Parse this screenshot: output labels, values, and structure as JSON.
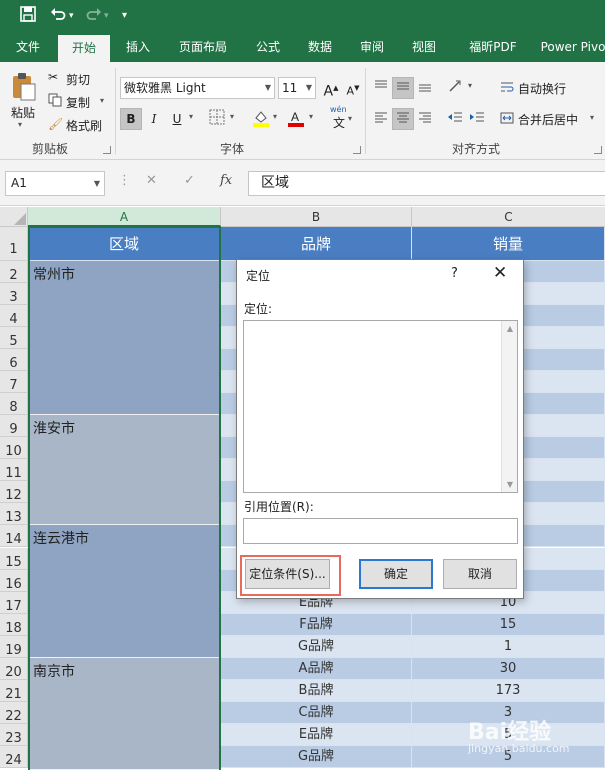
{
  "title_bar": {
    "save_icon": "save-icon",
    "undo_icon": "undo-icon",
    "redo_icon": "redo-icon",
    "customize_icon": "chevron-down-icon"
  },
  "ribbon_tabs": [
    "文件",
    "开始",
    "插入",
    "页面布局",
    "公式",
    "数据",
    "审阅",
    "视图",
    "福昕PDF",
    "Power Pivo"
  ],
  "active_tab": "开始",
  "clipboard": {
    "paste": "粘贴",
    "cut": "剪切",
    "copy": "复制",
    "format_painter": "格式刷",
    "group": "剪贴板"
  },
  "font": {
    "name": "微软雅黑 Light",
    "size": "11",
    "grow": "A",
    "shrink": "A",
    "bold": "B",
    "italic": "I",
    "underline": "U",
    "wen": "wén",
    "wen_char": "文",
    "group": "字体"
  },
  "alignment": {
    "wrap": "自动换行",
    "merge": "合并后居中",
    "group": "对齐方式"
  },
  "formula_bar": {
    "name_box": "A1",
    "fx": "fx",
    "value": "区域"
  },
  "columns": [
    "A",
    "B",
    "C"
  ],
  "row_numbers": [
    "1",
    "2",
    "3",
    "4",
    "5",
    "6",
    "7",
    "8",
    "9",
    "10",
    "11",
    "12",
    "13",
    "14",
    "15",
    "16",
    "17",
    "18",
    "19",
    "20",
    "21",
    "22",
    "23",
    "24"
  ],
  "header_row": {
    "a": "区域",
    "b": "品牌",
    "c": "销量"
  },
  "regions": [
    "常州市",
    "淮安市",
    "连云港市",
    "南京市"
  ],
  "visible_rows": [
    {
      "row": "17",
      "brand": "E品牌",
      "sales": "10"
    },
    {
      "row": "18",
      "brand": "F品牌",
      "sales": "15"
    },
    {
      "row": "19",
      "brand": "G品牌",
      "sales": "1"
    },
    {
      "row": "20",
      "brand": "A品牌",
      "sales": "30"
    },
    {
      "row": "21",
      "brand": "B品牌",
      "sales": "173"
    },
    {
      "row": "22",
      "brand": "C品牌",
      "sales": "3"
    },
    {
      "row": "23",
      "brand": "E品牌",
      "sales": "5"
    },
    {
      "row": "24",
      "brand": "G品牌",
      "sales": "5"
    }
  ],
  "dialog": {
    "title": "定位",
    "help": "?",
    "close": "✕",
    "goto_label": "定位:",
    "ref_label": "引用位置(R):",
    "special_button": "定位条件(S)...",
    "ok_button": "确定",
    "cancel_button": "取消"
  },
  "watermark": {
    "text": "Bai经验",
    "url": "jingyan.baidu.com"
  }
}
